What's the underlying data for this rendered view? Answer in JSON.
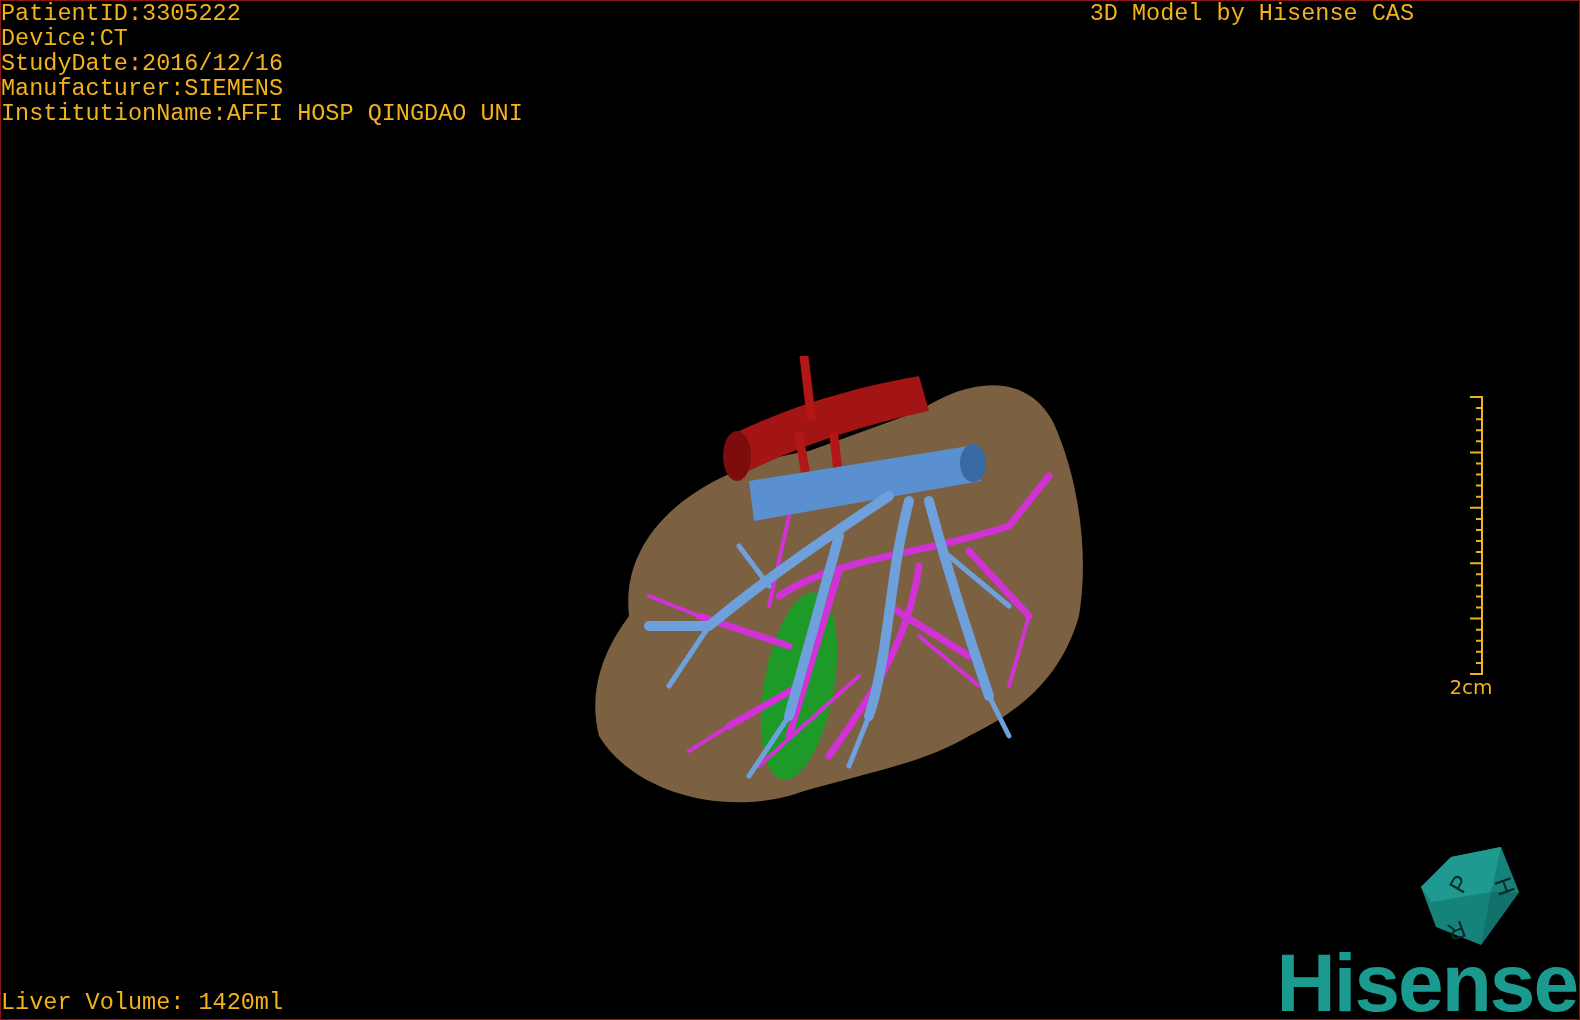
{
  "patient_info": [
    "PatientID:3305222",
    "Device:CT",
    "StudyDate:2016/12/16",
    "Manufacturer:SIEMENS",
    "InstitutionName:AFFI HOSP QINGDAO UNI"
  ],
  "title": "3D Model by Hisense CAS",
  "scale_bar": {
    "label": "2cm"
  },
  "liver_volume": "Liver Volume: 1420ml",
  "orientation_cube": {
    "labels": [
      "P",
      "H",
      "R"
    ]
  },
  "logo": "Hisense"
}
